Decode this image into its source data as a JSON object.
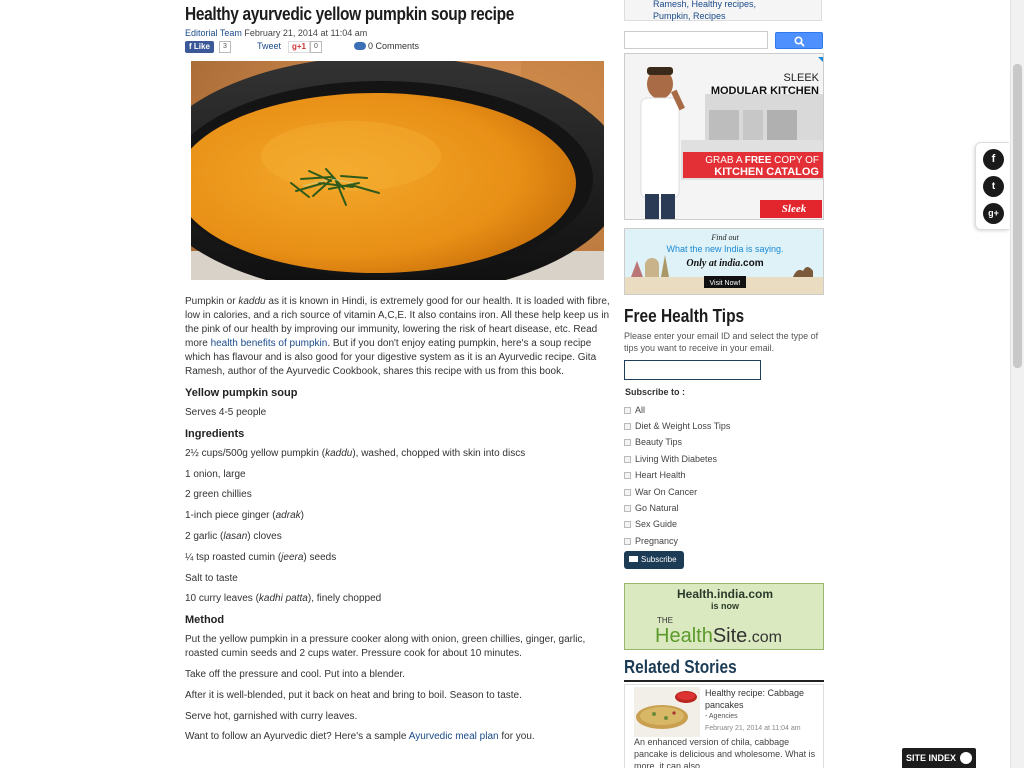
{
  "article": {
    "title": "Healthy ayurvedic yellow pumpkin soup recipe",
    "author": "Editorial Team",
    "date": "February 21, 2014 at 11:04 am",
    "share": {
      "like_label": "Like",
      "like_count": "3",
      "tweet_label": "Tweet",
      "gplus_label": "g+1",
      "gplus_count": "0",
      "comments": "0 Comments"
    },
    "intro": {
      "part1": "Pumpkin or ",
      "kaddu": "kaddu",
      "part2": " as it is known in Hindi, is extremely good for our health. It is loaded with fibre, low in calories, and a rich source of vitamin A,C,E. It also contains iron. All these help keep us in the pink of our health by improving our immunity, lowering the risk of heart disease, etc. Read more ",
      "link": "health benefits of pumpkin",
      "part3": ". But if you don't enjoy eating pumpkin, here's a soup recipe which has flavour and is also good for your digestive system as it is an Ayurvedic recipe. Gita Ramesh, author of the Ayurvedic Cookbook, shares this recipe with us from this book."
    },
    "recipe_title": "Yellow pumpkin soup",
    "serves": "Serves 4-5 people",
    "ingredients_heading": "Ingredients",
    "ingredients": [
      {
        "pre": "2½ cups/500g yellow pumpkin (",
        "it": "kaddu",
        "post": "), washed, chopped with skin into discs"
      },
      {
        "pre": "1 onion, large",
        "it": "",
        "post": ""
      },
      {
        "pre": "2 green chillies",
        "it": "",
        "post": ""
      },
      {
        "pre": "1-inch piece ginger (",
        "it": "adrak",
        "post": ")"
      },
      {
        "pre": "2 garlic (",
        "it": "lasan",
        "post": ") cloves"
      },
      {
        "pre": "¼ tsp roasted cumin (",
        "it": "jeera",
        "post": ") seeds"
      },
      {
        "pre": "Salt to taste",
        "it": "",
        "post": ""
      },
      {
        "pre": "10 curry leaves (",
        "it": "kadhi patta",
        "post": "), finely chopped"
      }
    ],
    "method_heading": "Method",
    "method": [
      "Put the yellow pumpkin in a pressure cooker along with onion, green chillies, ginger, garlic, roasted cumin seeds and 2 cups water. Pressure cook for about 10 minutes.",
      "Take off the pressure and cool. Put into a blender.",
      "After it is well-blended, put it back on heat and bring to boil. Season to taste.",
      "Serve hot, garnished with curry leaves."
    ],
    "diet_pre": "Want to follow an Ayurvedic diet? Here's a sample ",
    "diet_link": "Ayurvedic meal plan",
    "diet_post": " for you."
  },
  "sidebar": {
    "tags": "Ramesh, Healthy recipes, Pumpkin, Recipes",
    "ad1": {
      "brand_top": "SLEEK",
      "line1": "MODULAR KITCHEN",
      "cta1_pre": "GRAB A ",
      "cta1_free": "FREE",
      "cta1_post": " COPY OF",
      "cta2": "KITCHEN CATALOG",
      "logo": "Sleek"
    },
    "ad2": {
      "line1": "Find out",
      "line2": "What the new India is saying.",
      "line3": "Only at india",
      "line3_suffix": ".com",
      "button": "Visit Now!"
    },
    "free_tips_title": "Free Health Tips",
    "free_tips_desc": "Please enter your email ID and select the type of tips you want to receive in your email.",
    "subscribe_to": "Subscribe to :",
    "tips": [
      "All",
      "Diet & Weight Loss Tips",
      "Beauty Tips",
      "Living With Diabetes",
      "Heart Health",
      "War On Cancer",
      "Go Natural",
      "Sex Guide",
      "Pregnancy"
    ],
    "subscribe_button": "Subscribe",
    "health_banner": {
      "line1": "Health.india.com",
      "line2": "is now",
      "logo_the": "THE",
      "logo_health": "Health",
      "logo_site": "Site",
      "logo_com": ".com"
    },
    "related_title": "Related Stories",
    "related": {
      "headline": "Healthy recipe: Cabbage pancakes",
      "source": "- Agencies",
      "date": "February 21, 2014 at 11:04 am",
      "text": "An enhanced version of chila, cabbage pancake is delicious and wholesome. What is more, it can also ..."
    }
  },
  "social": {
    "facebook": "f",
    "twitter": "t",
    "gplus": "g+"
  },
  "site_index": "SITE INDEX"
}
